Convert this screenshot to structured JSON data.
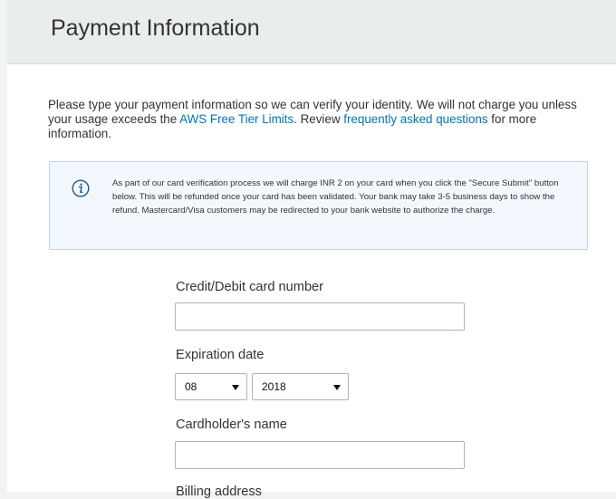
{
  "header": {
    "title": "Payment Information"
  },
  "intro": {
    "text_before": "Please type your payment information so we can verify your identity. We will not charge you unless your usage exceeds the ",
    "free_tier_link": "AWS Free Tier Limits",
    "text_middle": ". Review ",
    "faq_link": "frequently asked questions",
    "text_after": " for more information."
  },
  "notice": {
    "icon": "info-icon",
    "text": "As part of our card verification process we will charge INR 2 on your card when you click the \"Secure Submit\" button below. This will be refunded once your card has been validated. Your bank may take 3-5 business days to show the refund. Mastercard/Visa customers may be redirected to your bank website to authorize the charge."
  },
  "form": {
    "card_number_label": "Credit/Debit card number",
    "card_number_value": "",
    "expiration_label": "Expiration date",
    "expiration_month": "08",
    "expiration_year": "2018",
    "cardholder_label": "Cardholder's name",
    "cardholder_value": "",
    "billing_label": "Billing address"
  },
  "colors": {
    "link": "#0073bb",
    "header_bg": "#eaeded",
    "notice_bg": "#f2f8fd",
    "notice_border": "#c4d5e5",
    "input_border": "#aab7b8"
  }
}
